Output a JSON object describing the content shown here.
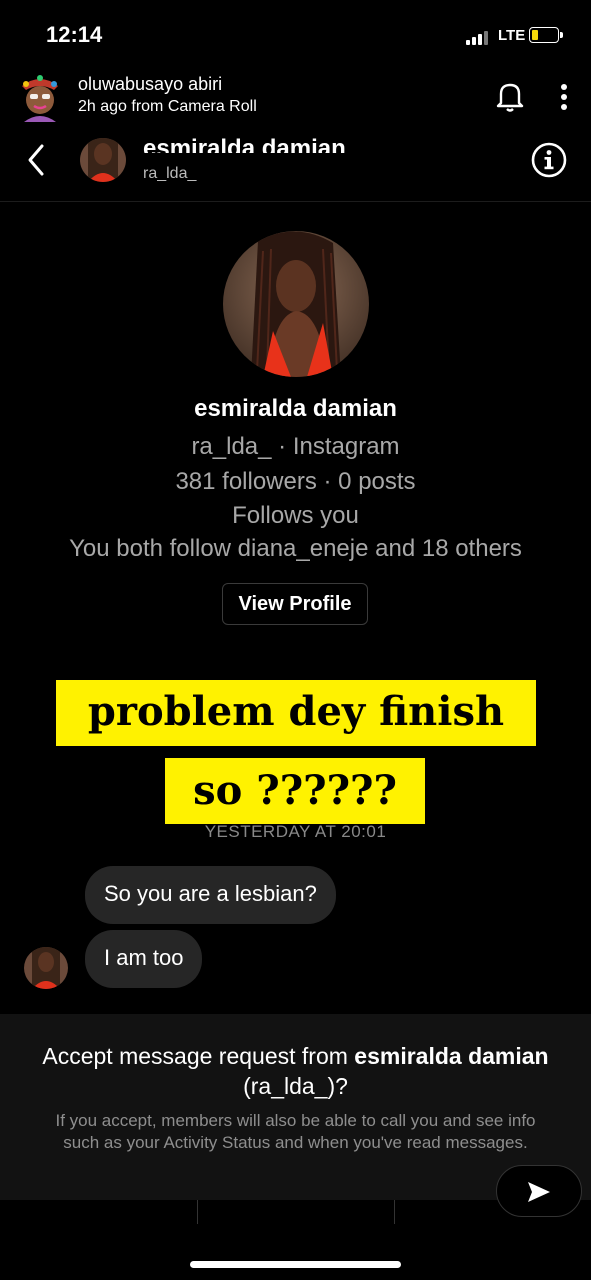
{
  "status_bar": {
    "time": "12:14",
    "network": "LTE",
    "battery_color": "#f5d90a"
  },
  "story": {
    "username": "oluwabusayo abiri",
    "meta": "2h ago from Camera Roll",
    "icons": [
      "bell-icon",
      "more-vertical-icon"
    ]
  },
  "chat_header": {
    "name": "esmiralda damian",
    "handle": "ra_lda_",
    "icons": [
      "back-chevron-icon",
      "info-icon"
    ]
  },
  "profile": {
    "name": "esmiralda damian",
    "handle_line": "ra_lda_ · Instagram",
    "stats": "381 followers · 0 posts",
    "follows": "Follows you",
    "mutual": "You both follow diana_eneje and 18 others",
    "view_profile_label": "View Profile"
  },
  "captions": {
    "line1": "problem dey finish",
    "line2": "so ??????",
    "highlight_color": "#fff200"
  },
  "timestamp": "YESTERDAY AT 20:01",
  "messages": [
    {
      "text": "So you are a lesbian?"
    },
    {
      "text": "I am too"
    }
  ],
  "request": {
    "title_prefix": "Accept message request from ",
    "title_name": "esmiralda damian",
    "title_handle": "(ra_lda_)?",
    "body": "If you accept, members will also be able to call you and see info such as your Activity Status and when you've read messages."
  }
}
